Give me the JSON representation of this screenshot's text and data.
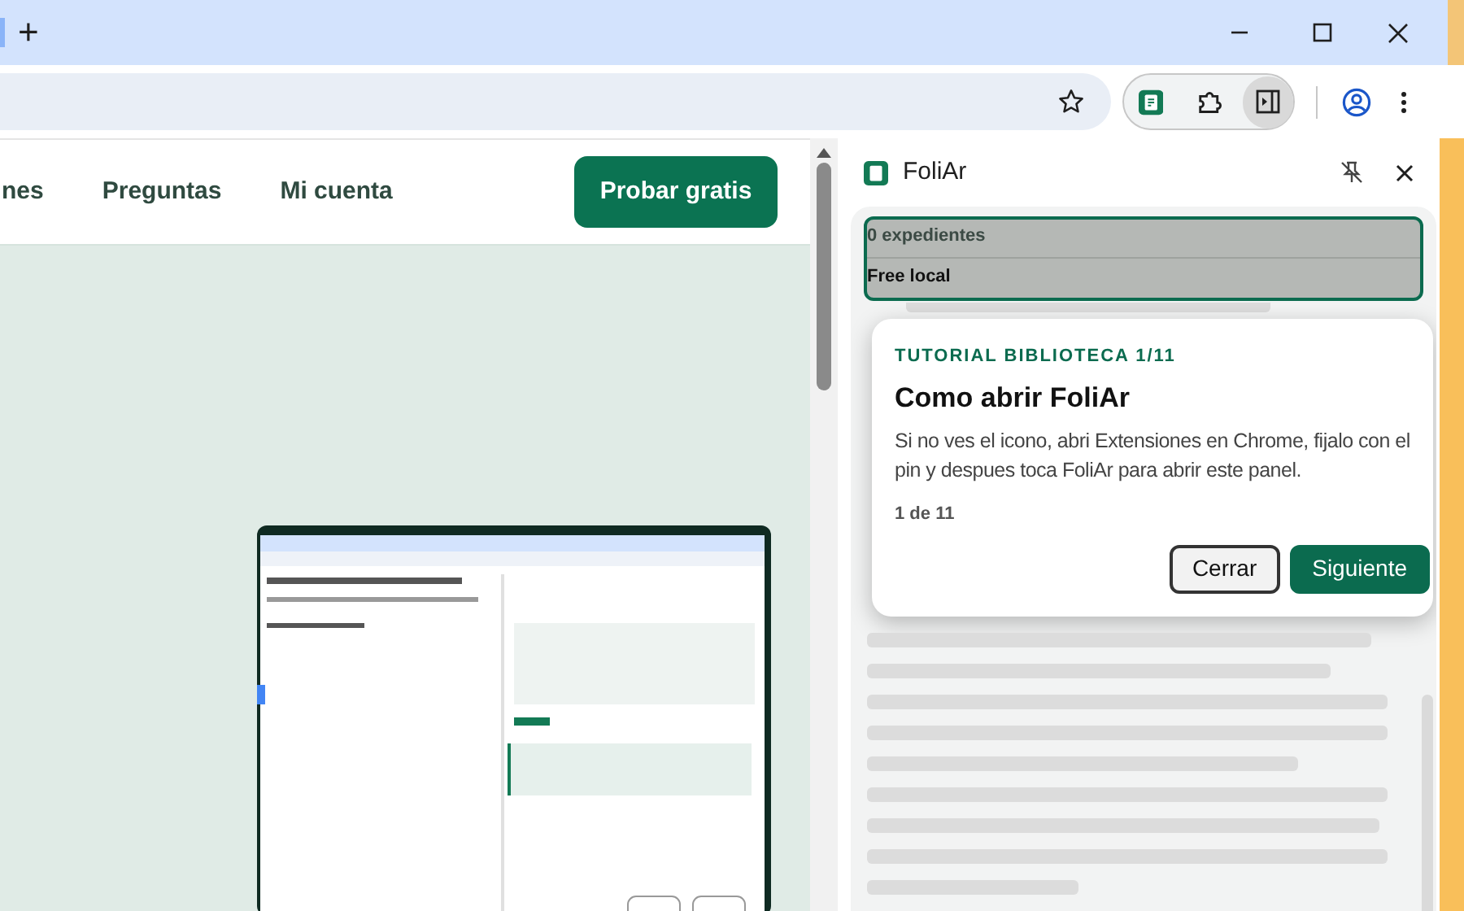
{
  "browser": {
    "new_tab": "+",
    "bookmarked": false
  },
  "page": {
    "nav": [
      "nes",
      "Preguntas",
      "Mi cuenta"
    ],
    "cta": "Probar gratis"
  },
  "side_panel": {
    "title": "FoliAr",
    "highlight": {
      "count": "0 expedientes",
      "plan": "Free local"
    },
    "tour": {
      "eyebrow": "TUTORIAL BIBLIOTECA 1/11",
      "title": "Como abrir FoliAr",
      "body": "Si no ves el icono, abri Extensiones en Chrome, fijalo con el pin y despues toca FoliAr para abrir este panel.",
      "progress": "1 de 11",
      "buttons": [
        {
          "label": "Cerrar",
          "kind": "secondary"
        },
        {
          "label": "Siguiente",
          "kind": "primary"
        }
      ]
    }
  }
}
